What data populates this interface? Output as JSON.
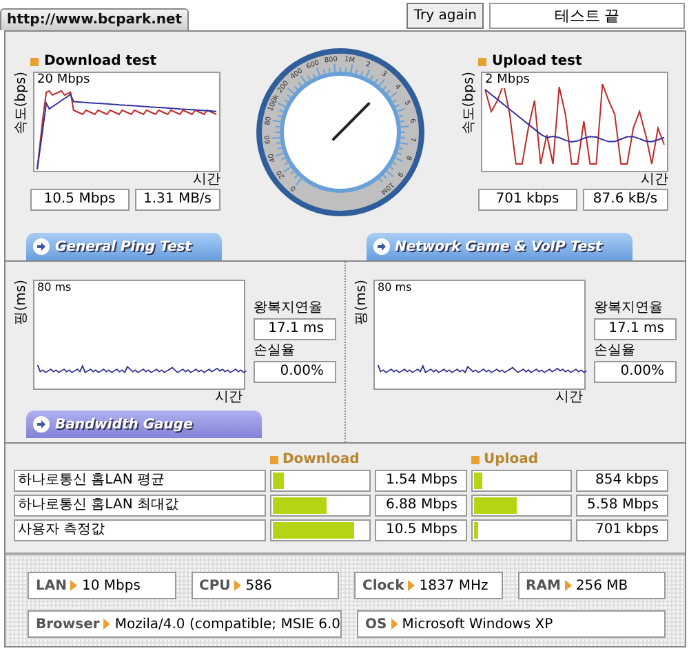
{
  "header": {
    "site": "http://www.bcpark.net",
    "retry_button": "Try again",
    "status": "테스트 끝"
  },
  "download": {
    "title": "Download test",
    "ylabel": "속도(bps)",
    "scale": "20 Mbps",
    "xlabel": "시간",
    "rate": "10.5 Mbps",
    "bytes": "1.31 MB/s"
  },
  "gauge": {
    "labels": [
      "0",
      "20",
      "40",
      "60",
      "80",
      "100k",
      "200",
      "400",
      "600",
      "800",
      "1M",
      "2",
      "3",
      "4",
      "5",
      "6",
      "7",
      "8",
      "9",
      "10M"
    ],
    "level": 0.66
  },
  "upload": {
    "title": "Upload test",
    "ylabel": "속도(bps)",
    "scale": "2 Mbps",
    "xlabel": "시간",
    "rate": "701 kbps",
    "bytes": "87.6 kB/s"
  },
  "section_tabs": [
    {
      "label": "General Ping Test"
    },
    {
      "label": "Network Game & VoIP Test"
    }
  ],
  "ping_panels": [
    {
      "ylabel": "핑(ms)",
      "scale": "80 ms",
      "xlabel": "시간",
      "latency_label": "왕복지연율",
      "latency": "17.1 ms",
      "loss_label": "손실율",
      "loss": "0.00%"
    },
    {
      "ylabel": "핑(ms)",
      "scale": "80 ms",
      "xlabel": "시간",
      "latency_label": "왕복지연율",
      "latency": "17.1 ms",
      "loss_label": "손실율",
      "loss": "0.00%"
    }
  ],
  "bandwidth": {
    "tab": "Bandwidth Gauge",
    "download_heading": "Download",
    "upload_heading": "Upload",
    "rows": [
      {
        "label": "하나로통신 홈LAN 평균",
        "download": {
          "level": 0.12,
          "value": "1.54 Mbps"
        },
        "upload": {
          "level": 0.08,
          "value": "854 kbps"
        }
      },
      {
        "label": "하나로통신 홈LAN 최대값",
        "download": {
          "level": 0.56,
          "value": "6.88 Mbps"
        },
        "upload": {
          "level": 0.45,
          "value": "5.58 Mbps"
        }
      },
      {
        "label": "사용자 측정값",
        "download": {
          "level": 0.86,
          "value": "10.5 Mbps"
        },
        "upload": {
          "level": 0.05,
          "value": "701 kbps"
        }
      }
    ]
  },
  "system_info": [
    [
      {
        "label": "LAN",
        "value": "10 Mbps"
      },
      {
        "label": "CPU",
        "value": "586"
      },
      {
        "label": "Clock",
        "value": "1837 MHz"
      },
      {
        "label": "RAM",
        "value": "256 MB"
      }
    ],
    [
      {
        "label": "Browser",
        "value": "Mozila/4.0 (compatible; MSIE 6.0"
      },
      {
        "label": "OS",
        "value": "Microsoft Windows XP"
      }
    ]
  ]
}
